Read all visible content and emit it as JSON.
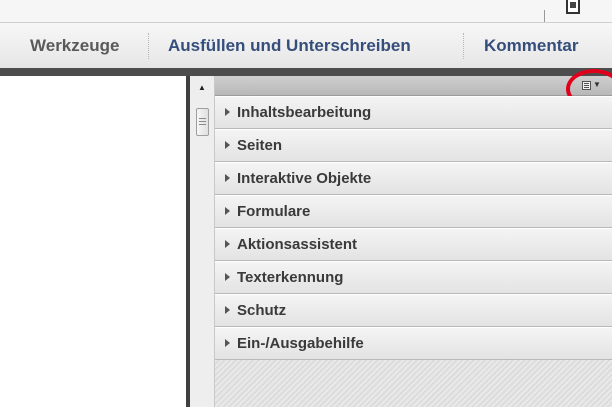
{
  "toolbar": {
    "tools_label": "Werkzeuge",
    "fill_sign_label": "Ausfüllen und Unterschreiben",
    "comment_label": "Kommentar"
  },
  "panel": {
    "items": [
      {
        "label": "Inhaltsbearbeitung"
      },
      {
        "label": "Seiten"
      },
      {
        "label": "Interaktive Objekte"
      },
      {
        "label": "Formulare"
      },
      {
        "label": "Aktionsassistent"
      },
      {
        "label": "Texterkennung"
      },
      {
        "label": "Schutz"
      },
      {
        "label": "Ein-/Ausgabehilfe"
      }
    ],
    "options_icon": "panel-options-icon"
  },
  "colors": {
    "toolbar_link": "#354e7c",
    "highlight_circle": "#e0001b",
    "dark_bar": "#4d4d4d"
  }
}
